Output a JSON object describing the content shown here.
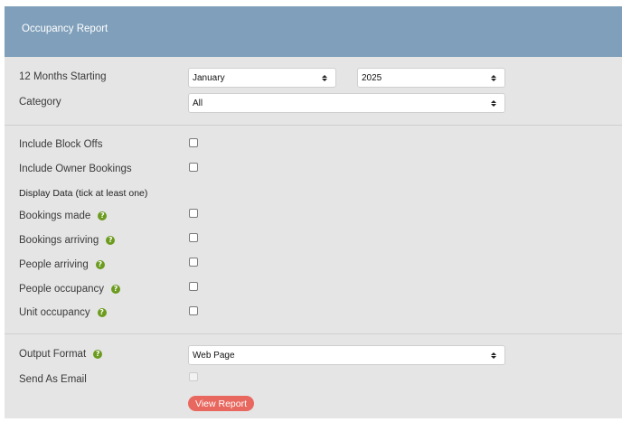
{
  "header": {
    "title": "Occupancy Report"
  },
  "period": {
    "label": "12 Months Starting",
    "month_value": "January",
    "year_value": "2025"
  },
  "category": {
    "label": "Category",
    "value": "All"
  },
  "options": {
    "include_block_offs": {
      "label": "Include Block Offs",
      "checked": false
    },
    "include_owner_bookings": {
      "label": "Include Owner Bookings",
      "checked": false
    }
  },
  "display_data": {
    "heading": "Display Data (tick at least one)",
    "items": [
      {
        "label": "Bookings made",
        "checked": false
      },
      {
        "label": "Bookings arriving",
        "checked": false
      },
      {
        "label": "People arriving",
        "checked": false
      },
      {
        "label": "People occupancy",
        "checked": false
      },
      {
        "label": "Unit occupancy",
        "checked": false
      }
    ]
  },
  "output": {
    "label": "Output Format",
    "value": "Web Page",
    "email_label": "Send As Email",
    "email_checked": false,
    "submit_label": "View Report"
  },
  "icons": {
    "help": "help-question-icon",
    "select_arrows": "select-arrows-icon"
  },
  "colors": {
    "header_bg": "#7f9fba",
    "panel_bg": "#e5e5e5",
    "help_green": "#6c9b1f",
    "button_red": "#e8675e"
  }
}
